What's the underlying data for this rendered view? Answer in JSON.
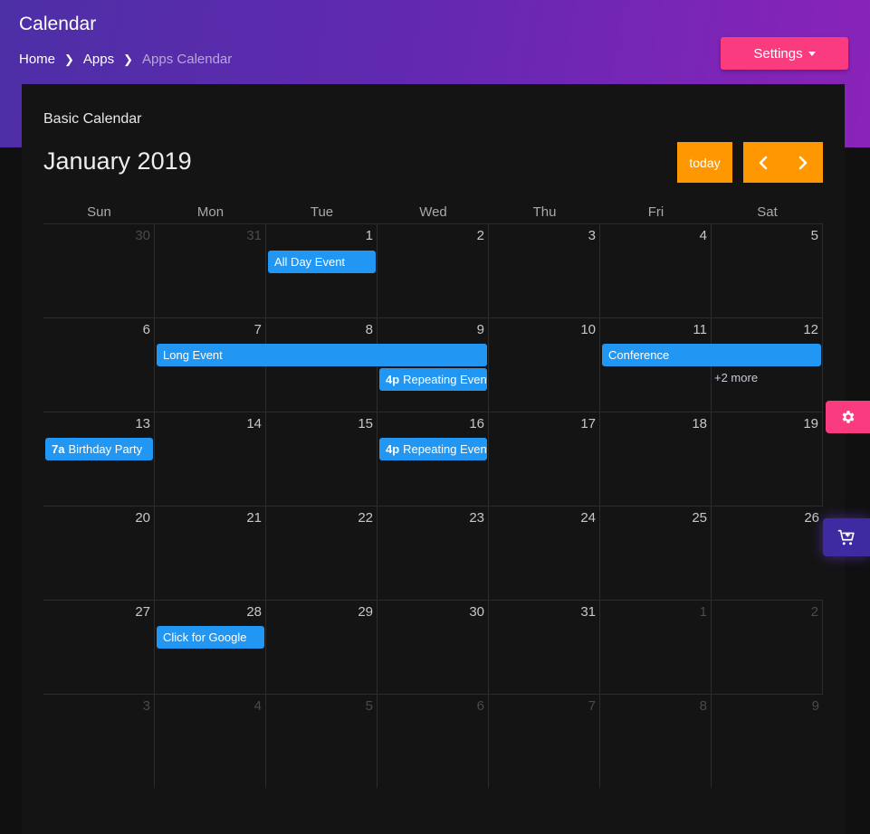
{
  "header": {
    "title": "Calendar",
    "breadcrumb": [
      "Home",
      "Apps",
      "Apps Calendar"
    ],
    "settings_label": "Settings"
  },
  "card": {
    "title": "Basic Calendar",
    "month": "January 2019",
    "today_label": "today",
    "prev_icon": "chevron-left-icon",
    "next_icon": "chevron-right-icon"
  },
  "calendar": {
    "weekdays": [
      "Sun",
      "Mon",
      "Tue",
      "Wed",
      "Thu",
      "Fri",
      "Sat"
    ],
    "weeks": [
      [
        {
          "d": "30",
          "other": true
        },
        {
          "d": "31",
          "other": true
        },
        {
          "d": "1"
        },
        {
          "d": "2"
        },
        {
          "d": "3"
        },
        {
          "d": "4"
        },
        {
          "d": "5"
        }
      ],
      [
        {
          "d": "6"
        },
        {
          "d": "7"
        },
        {
          "d": "8"
        },
        {
          "d": "9"
        },
        {
          "d": "10"
        },
        {
          "d": "11"
        },
        {
          "d": "12"
        }
      ],
      [
        {
          "d": "13"
        },
        {
          "d": "14"
        },
        {
          "d": "15"
        },
        {
          "d": "16"
        },
        {
          "d": "17"
        },
        {
          "d": "18"
        },
        {
          "d": "19"
        }
      ],
      [
        {
          "d": "20"
        },
        {
          "d": "21"
        },
        {
          "d": "22"
        },
        {
          "d": "23"
        },
        {
          "d": "24"
        },
        {
          "d": "25"
        },
        {
          "d": "26"
        }
      ],
      [
        {
          "d": "27"
        },
        {
          "d": "28"
        },
        {
          "d": "29"
        },
        {
          "d": "30"
        },
        {
          "d": "31"
        },
        {
          "d": "1",
          "other": true
        },
        {
          "d": "2",
          "other": true
        }
      ],
      [
        {
          "d": "3",
          "other": true
        },
        {
          "d": "4",
          "other": true
        },
        {
          "d": "5",
          "other": true
        },
        {
          "d": "6",
          "other": true
        },
        {
          "d": "7",
          "other": true
        },
        {
          "d": "8",
          "other": true
        },
        {
          "d": "9",
          "other": true
        }
      ]
    ],
    "events": [
      {
        "title": "All Day Event"
      },
      {
        "title": "Long Event"
      },
      {
        "time": "4p",
        "title": "Repeating Event"
      },
      {
        "title": "Conference"
      },
      {
        "time": "7a",
        "title": "Birthday Party"
      },
      {
        "time": "4p",
        "title": "Repeating Event"
      },
      {
        "title": "Click for Google"
      }
    ],
    "more_label": "+2 more"
  },
  "side": {
    "gear_icon": "gear-icon",
    "cart_icon": "cart-plus-icon"
  },
  "colors": {
    "header_gradient_start": "#4d2fa6",
    "header_gradient_end": "#8a23b9",
    "settings_button": "#fb3b7f",
    "today_button": "#ff9800",
    "event": "#2196f3",
    "cart_button": "#3e2ba2"
  }
}
